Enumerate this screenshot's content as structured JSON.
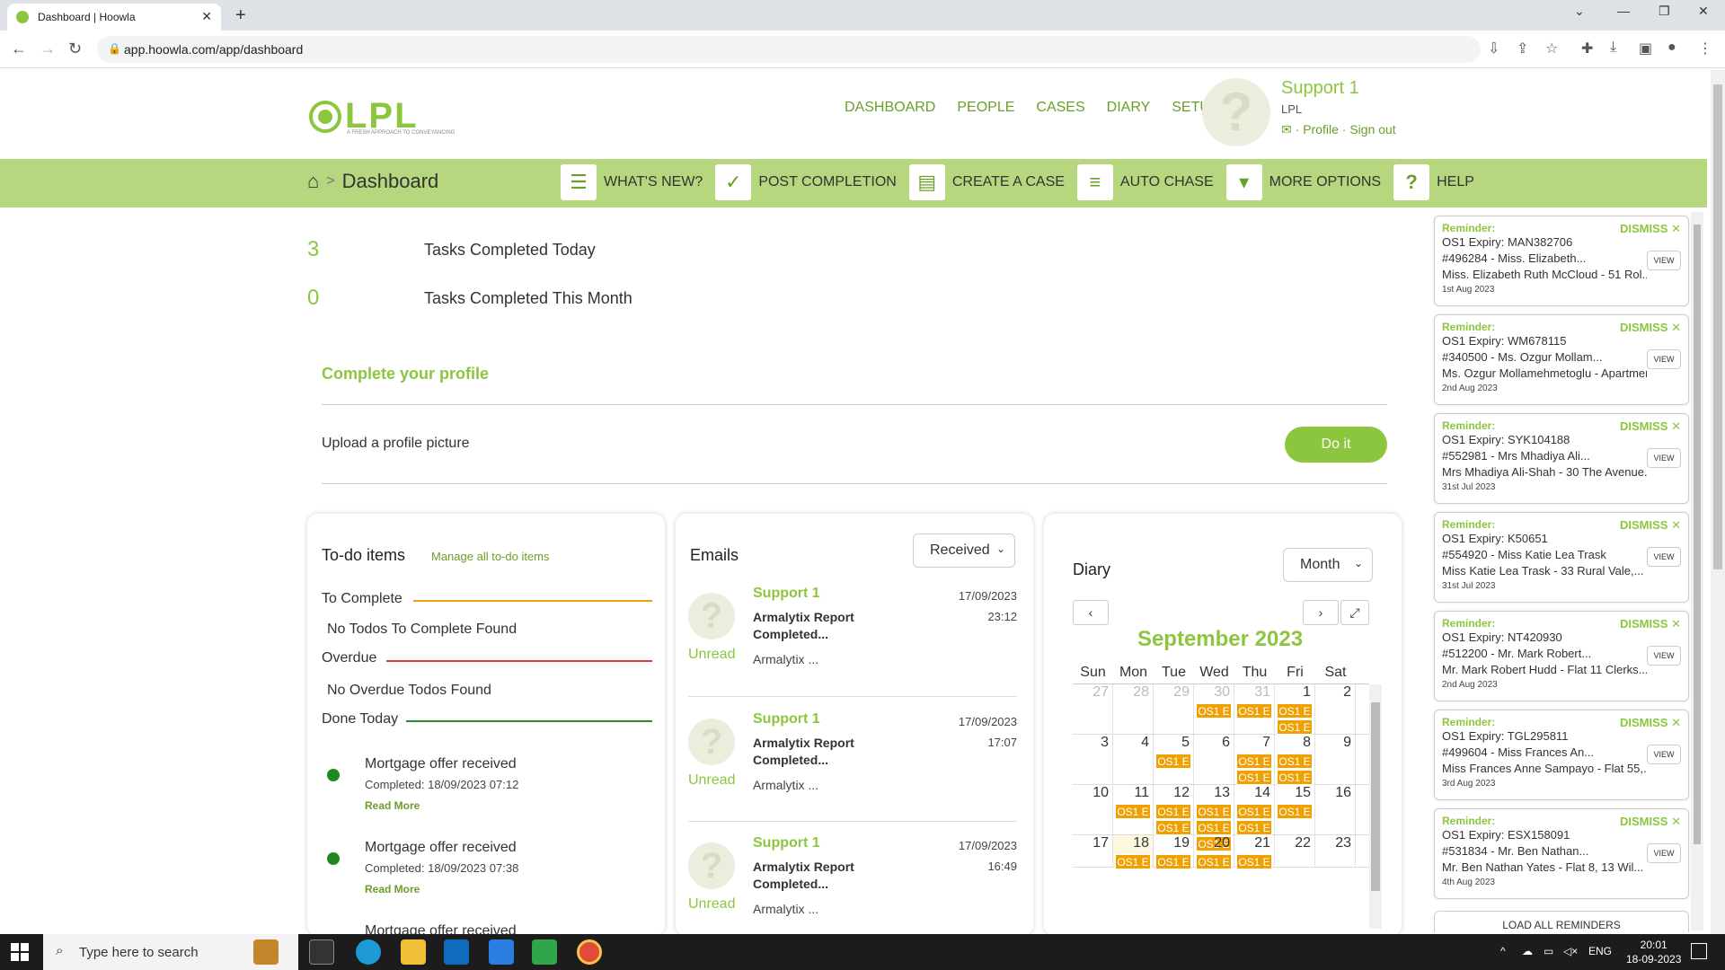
{
  "browser": {
    "tab_title": "Dashboard | Hoowla",
    "url": "app.hoowla.com/app/dashboard"
  },
  "header": {
    "logo_text": "LPL",
    "logo_tagline": "A FRESH APPROACH TO CONVEYANCING",
    "nav": [
      "DASHBOARD",
      "PEOPLE",
      "CASES",
      "DIARY",
      "SETUP"
    ],
    "user_name": "Support 1",
    "user_org": "LPL",
    "profile_link": "Profile",
    "signout_link": "Sign out"
  },
  "toolbar": {
    "breadcrumb": "Dashboard",
    "actions": [
      "WHAT'S NEW?",
      "POST COMPLETION",
      "CREATE A CASE",
      "AUTO CHASE",
      "MORE OPTIONS",
      "HELP"
    ]
  },
  "stats": [
    {
      "value": "3",
      "label": "Tasks Completed Today"
    },
    {
      "value": "0",
      "label": "Tasks Completed This Month"
    }
  ],
  "profile": {
    "title": "Complete your profile",
    "task": "Upload a profile picture",
    "button": "Do it"
  },
  "todos": {
    "title": "To-do items",
    "manage_link": "Manage all to-do items",
    "sections": {
      "to_complete": "To Complete",
      "to_complete_empty": "No Todos To Complete Found",
      "overdue": "Overdue",
      "overdue_empty": "No Overdue Todos Found",
      "done_today": "Done Today"
    },
    "done_items": [
      {
        "title": "Mortgage offer received",
        "completed": "Completed: 18/09/2023 07:12",
        "link": "Read More"
      },
      {
        "title": "Mortgage offer received",
        "completed": "Completed: 18/09/2023 07:38",
        "link": "Read More"
      },
      {
        "title": "Mortgage offer received",
        "completed": "",
        "link": ""
      }
    ]
  },
  "emails": {
    "title": "Emails",
    "filter": "Received",
    "items": [
      {
        "from": "Support 1",
        "subject": "Armalytix Report Completed...",
        "preview": "Armalytix ...",
        "date": "17/09/2023",
        "time": "23:12",
        "status": "Unread"
      },
      {
        "from": "Support 1",
        "subject": "Armalytix Report Completed...",
        "preview": "Armalytix ...",
        "date": "17/09/2023",
        "time": "17:07",
        "status": "Unread"
      },
      {
        "from": "Support 1",
        "subject": "Armalytix Report Completed...",
        "preview": "Armalytix ...",
        "date": "17/09/2023",
        "time": "16:49",
        "status": "Unread"
      }
    ]
  },
  "diary": {
    "title": "Diary",
    "view": "Month",
    "month_title": "September 2023",
    "weekdays": [
      "Sun",
      "Mon",
      "Tue",
      "Wed",
      "Thu",
      "Fri",
      "Sat"
    ],
    "event_label": "OS1 E",
    "weeks": [
      [
        {
          "d": "27",
          "m": true,
          "e": 0
        },
        {
          "d": "28",
          "m": true,
          "e": 0
        },
        {
          "d": "29",
          "m": true,
          "e": 0
        },
        {
          "d": "30",
          "m": true,
          "e": 1
        },
        {
          "d": "31",
          "m": true,
          "e": 1
        },
        {
          "d": "1",
          "e": 2
        },
        {
          "d": "2",
          "e": 0
        }
      ],
      [
        {
          "d": "3",
          "e": 0
        },
        {
          "d": "4",
          "e": 0
        },
        {
          "d": "5",
          "e": 1
        },
        {
          "d": "6",
          "e": 0
        },
        {
          "d": "7",
          "e": 2
        },
        {
          "d": "8",
          "e": 2
        },
        {
          "d": "9",
          "e": 0
        }
      ],
      [
        {
          "d": "10",
          "e": 0
        },
        {
          "d": "11",
          "e": 1
        },
        {
          "d": "12",
          "e": 2
        },
        {
          "d": "13",
          "e": 3
        },
        {
          "d": "14",
          "e": 2
        },
        {
          "d": "15",
          "e": 1
        },
        {
          "d": "16",
          "e": 0
        }
      ],
      [
        {
          "d": "17",
          "e": 0
        },
        {
          "d": "18",
          "e": 1,
          "today": true
        },
        {
          "d": "19",
          "e": 1
        },
        {
          "d": "20",
          "e": 1
        },
        {
          "d": "21",
          "e": 1
        },
        {
          "d": "22",
          "e": 0
        },
        {
          "d": "23",
          "e": 0
        }
      ]
    ]
  },
  "reminders": {
    "header": "Reminder:",
    "dismiss": "DISMISS",
    "view": "VIEW",
    "load_all": "LOAD ALL REMINDERS",
    "items": [
      {
        "line1": "OS1 Expiry: MAN382706",
        "line2": "#496284 - Miss. Elizabeth...",
        "line3": "Miss. Elizabeth Ruth McCloud - 51 Rol...",
        "date": "1st Aug 2023"
      },
      {
        "line1": "OS1 Expiry: WM678115",
        "line2": "#340500 - Ms. Ozgur Mollam...",
        "line3": "Ms. Ozgur Mollamehmetoglu - Apartment...",
        "date": "2nd Aug 2023"
      },
      {
        "line1": "OS1 Expiry: SYK104188",
        "line2": "#552981 - Mrs Mhadiya Ali...",
        "line3": "Mrs Mhadiya Ali-Shah - 30 The Avenue...",
        "date": "31st Jul 2023"
      },
      {
        "line1": "OS1 Expiry: K50651",
        "line2": "#554920 - Miss Katie Lea Trask",
        "line3": "Miss Katie Lea Trask - 33 Rural Vale,...",
        "date": "31st Jul 2023"
      },
      {
        "line1": "OS1 Expiry: NT420930",
        "line2": "#512200 - Mr. Mark Robert...",
        "line3": "Mr. Mark Robert Hudd - Flat 11 Clerks...",
        "date": "2nd Aug 2023"
      },
      {
        "line1": "OS1 Expiry: TGL295811",
        "line2": "#499604 - Miss Frances An...",
        "line3": "Miss Frances Anne Sampayo - Flat 55,...",
        "date": "3rd Aug 2023"
      },
      {
        "line1": "OS1 Expiry: ESX158091",
        "line2": "#531834 - Mr. Ben Nathan...",
        "line3": "Mr. Ben Nathan Yates - Flat 8, 13 Wil...",
        "date": "4th Aug 2023"
      }
    ]
  },
  "taskbar": {
    "search_placeholder": "Type here to search",
    "lang": "ENG",
    "time": "20:01",
    "date": "18-09-2023"
  }
}
